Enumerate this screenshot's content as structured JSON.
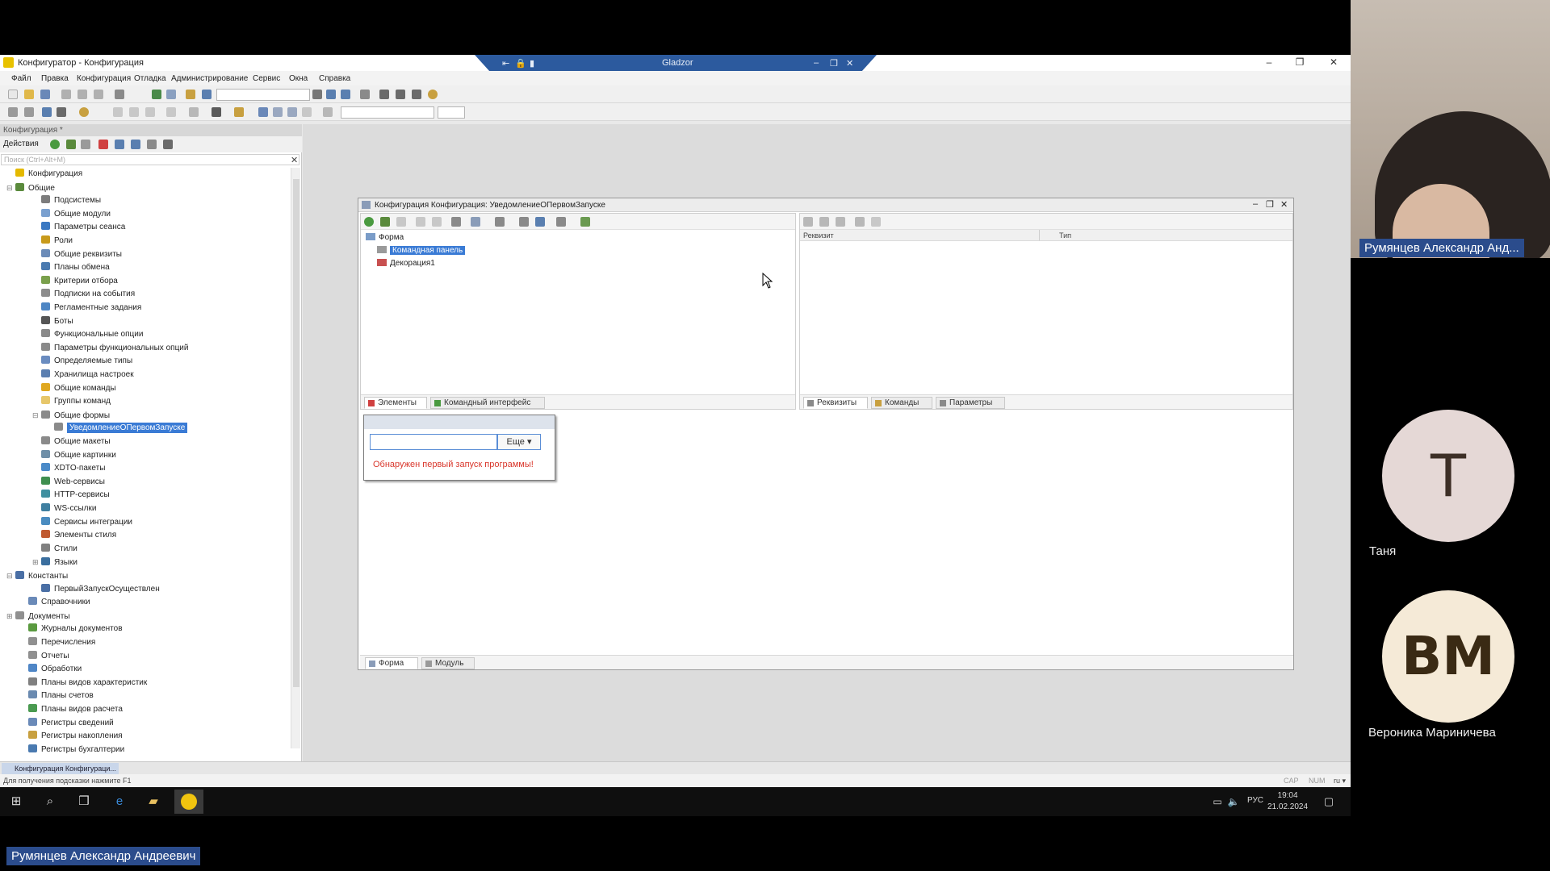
{
  "window": {
    "title": "Конфигуратор - Конфигурация",
    "remote_title": "Gladzor",
    "min": "–",
    "max": "❐",
    "close": "✕"
  },
  "menu": [
    "Файл",
    "Правка",
    "Конфигурация",
    "Отладка",
    "Администрирование",
    "Сервис",
    "Окна",
    "Справка"
  ],
  "tree_panel": {
    "header": "Конфигурация *",
    "actions_label": "Действия",
    "search_placeholder": "Поиск (Ctrl+Alt+M)",
    "items": [
      {
        "label": "Конфигурация",
        "level": 0,
        "exp": "",
        "icon": "#e4b900"
      },
      {
        "label": "Общие",
        "level": 0,
        "exp": "⊟",
        "icon": "#5a8a3c"
      },
      {
        "label": "Подсистемы",
        "level": 2,
        "exp": "",
        "icon": "#7c7c7c"
      },
      {
        "label": "Общие модули",
        "level": 2,
        "exp": "",
        "icon": "#7aa0cf"
      },
      {
        "label": "Параметры сеанса",
        "level": 2,
        "exp": "",
        "icon": "#3a78c2"
      },
      {
        "label": "Роли",
        "level": 2,
        "exp": "",
        "icon": "#c89a1c"
      },
      {
        "label": "Общие реквизиты",
        "level": 2,
        "exp": "",
        "icon": "#6b8bb8"
      },
      {
        "label": "Планы обмена",
        "level": 2,
        "exp": "",
        "icon": "#4a7ab0"
      },
      {
        "label": "Критерии отбора",
        "level": 2,
        "exp": "",
        "icon": "#7aa04c"
      },
      {
        "label": "Подписки на события",
        "level": 2,
        "exp": "",
        "icon": "#8c8c8c"
      },
      {
        "label": "Регламентные задания",
        "level": 2,
        "exp": "",
        "icon": "#4e86c4"
      },
      {
        "label": "Боты",
        "level": 2,
        "exp": "",
        "icon": "#555555"
      },
      {
        "label": "Функциональные опции",
        "level": 2,
        "exp": "",
        "icon": "#8a8a8a"
      },
      {
        "label": "Параметры функциональных опций",
        "level": 2,
        "exp": "",
        "icon": "#8a8a8a"
      },
      {
        "label": "Определяемые типы",
        "level": 2,
        "exp": "",
        "icon": "#6a8cc0"
      },
      {
        "label": "Хранилища настроек",
        "level": 2,
        "exp": "",
        "icon": "#5b7fb0"
      },
      {
        "label": "Общие команды",
        "level": 2,
        "exp": "",
        "icon": "#e0a820"
      },
      {
        "label": "Группы команд",
        "level": 2,
        "exp": "",
        "icon": "#e7c76a"
      },
      {
        "label": "Общие формы",
        "level": 2,
        "exp": "⊟",
        "icon": "#8a8a8a"
      },
      {
        "label": "УведомлениеОПервомЗапуске",
        "level": 3,
        "exp": "",
        "icon": "#8a8a8a",
        "selected": true
      },
      {
        "label": "Общие макеты",
        "level": 2,
        "exp": "",
        "icon": "#8a8a8a"
      },
      {
        "label": "Общие картинки",
        "level": 2,
        "exp": "",
        "icon": "#6f8fa8"
      },
      {
        "label": "XDTO-пакеты",
        "level": 2,
        "exp": "",
        "icon": "#4a8ac8"
      },
      {
        "label": "Web-сервисы",
        "level": 2,
        "exp": "",
        "icon": "#3f8f4f"
      },
      {
        "label": "HTTP-сервисы",
        "level": 2,
        "exp": "",
        "icon": "#3f8f9f"
      },
      {
        "label": "WS-ссылки",
        "level": 2,
        "exp": "",
        "icon": "#3f7fa0"
      },
      {
        "label": "Сервисы интеграции",
        "level": 2,
        "exp": "",
        "icon": "#4a8cc0"
      },
      {
        "label": "Элементы стиля",
        "level": 2,
        "exp": "",
        "icon": "#c05a30"
      },
      {
        "label": "Стили",
        "level": 2,
        "exp": "",
        "icon": "#808080"
      },
      {
        "label": "Языки",
        "level": 2,
        "exp": "⊞",
        "icon": "#3a6e9e"
      },
      {
        "label": "Константы",
        "level": 0,
        "exp": "⊟",
        "icon": "#4a6fa5"
      },
      {
        "label": "ПервыйЗапускОсуществлен",
        "level": 2,
        "exp": "",
        "icon": "#4a6fa5"
      },
      {
        "label": "Справочники",
        "level": 1,
        "exp": "",
        "icon": "#6a8ab8"
      },
      {
        "label": "Документы",
        "level": 0,
        "exp": "⊞",
        "icon": "#909090"
      },
      {
        "label": "Журналы документов",
        "level": 1,
        "exp": "",
        "icon": "#5a9a40"
      },
      {
        "label": "Перечисления",
        "level": 1,
        "exp": "",
        "icon": "#909090"
      },
      {
        "label": "Отчеты",
        "level": 1,
        "exp": "",
        "icon": "#909090"
      },
      {
        "label": "Обработки",
        "level": 1,
        "exp": "",
        "icon": "#4f86c6"
      },
      {
        "label": "Планы видов характеристик",
        "level": 1,
        "exp": "",
        "icon": "#808080"
      },
      {
        "label": "Планы счетов",
        "level": 1,
        "exp": "",
        "icon": "#6a8ab0"
      },
      {
        "label": "Планы видов расчета",
        "level": 1,
        "exp": "",
        "icon": "#4a9a50"
      },
      {
        "label": "Регистры сведений",
        "level": 1,
        "exp": "",
        "icon": "#6a8ab8"
      },
      {
        "label": "Регистры накопления",
        "level": 1,
        "exp": "",
        "icon": "#c8a040"
      },
      {
        "label": "Регистры бухгалтерии",
        "level": 1,
        "exp": "",
        "icon": "#4a7ab0"
      }
    ]
  },
  "form_window": {
    "title": "Конфигурация Конфигурация: УведомлениеОПервомЗапуске",
    "elements": [
      {
        "label": "Форма",
        "indent": 0,
        "icon": "#7a9cc8"
      },
      {
        "label": "Командная панель",
        "indent": 1,
        "icon": "#9a9a9a",
        "selected": true
      },
      {
        "label": "Декорация1",
        "indent": 1,
        "icon": "#c85050"
      }
    ],
    "left_tabs": [
      "Элементы",
      "Командный интерфейс"
    ],
    "right_columns": [
      "Реквизит",
      "Тип"
    ],
    "right_tabs": [
      "Реквизиты",
      "Команды",
      "Параметры"
    ],
    "bottom_tabs": [
      "Форма",
      "Модуль"
    ],
    "preview": {
      "more_button": "Еще ▾",
      "message": "Обнаружен первый запуск программы!"
    }
  },
  "window_bar": {
    "item": "Конфигурация Конфигураци..."
  },
  "status": {
    "hint": "Для получения подсказки нажмите F1",
    "cap": "CAP",
    "num": "NUM",
    "lang": "ru ▾"
  },
  "taskbar": {
    "lang": "РУС",
    "time": "19:04",
    "date": "21.02.2024"
  },
  "participants": {
    "speaker_tag": "Румянцев Александр Анд...",
    "p1_initials": "Т",
    "p1_name": "Таня",
    "p2_initials": "ВМ",
    "p2_name": "Вероника Мариничева",
    "bottom_tag": "Румянцев Александр Андреевич"
  },
  "colors": {
    "selection": "#3a7bd5",
    "error_text": "#d9372c",
    "avatar_t": "#e5d8d6",
    "avatar_vm": "#f5ead7"
  }
}
